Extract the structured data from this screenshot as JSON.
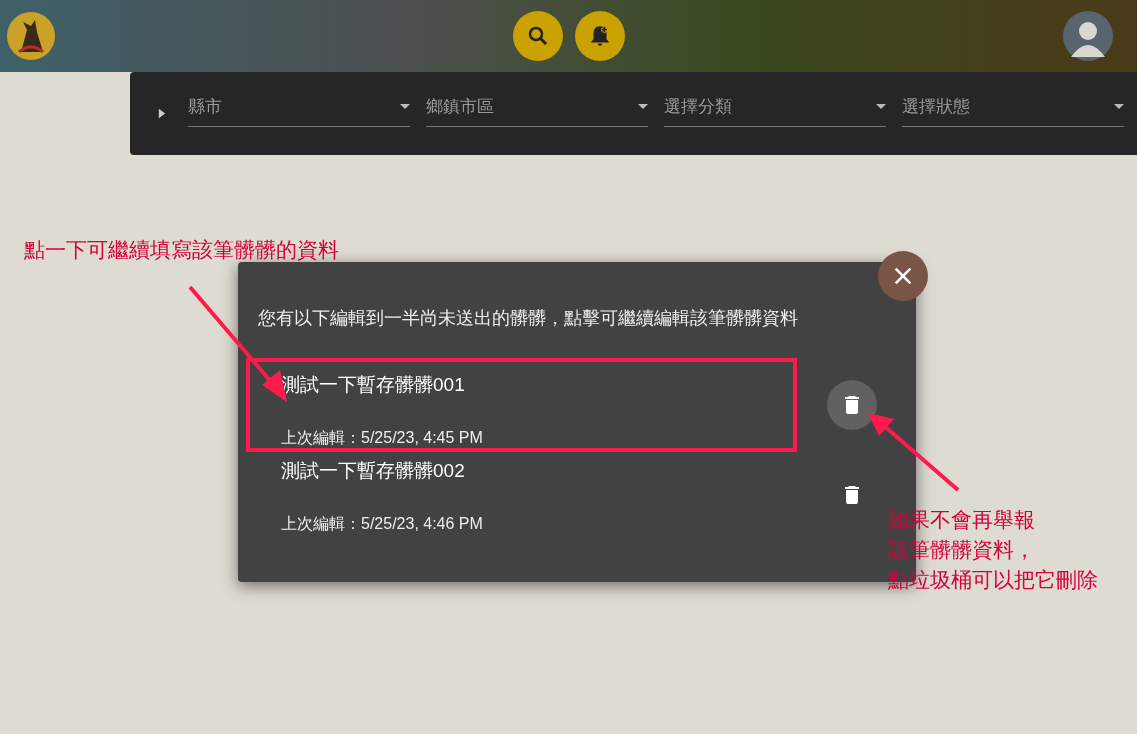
{
  "filters": [
    {
      "placeholder": "縣市"
    },
    {
      "placeholder": "鄉鎮市區"
    },
    {
      "placeholder": "選擇分類"
    },
    {
      "placeholder": "選擇狀態"
    }
  ],
  "dialog": {
    "message": "您有以下編輯到一半尚未送出的髒髒，點擊可繼續編輯該筆髒髒資料",
    "drafts": [
      {
        "title": "測試一下暫存髒髒001",
        "subtitle": "上次編輯：5/25/23, 4:45 PM",
        "highlighted": true
      },
      {
        "title": "測試一下暫存髒髒002",
        "subtitle": "上次編輯：5/25/23, 4:46 PM",
        "highlighted": false
      }
    ]
  },
  "annotations": {
    "left": "點一下可繼續填寫該筆髒髒的資料",
    "right": [
      "如果不會再舉報",
      "該筆髒髒資料，",
      "點垃圾桶可以把它刪除"
    ]
  }
}
